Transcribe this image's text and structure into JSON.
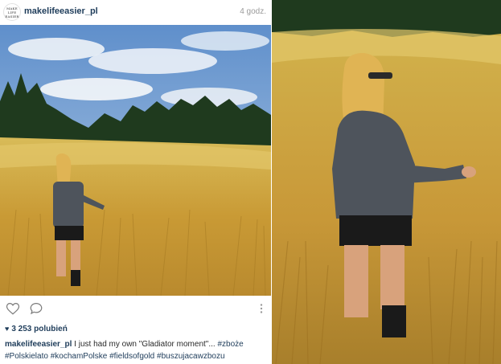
{
  "post": {
    "avatar_text": [
      "MAKE",
      "LIFE",
      "EASIER"
    ],
    "username": "makelifeeasier_pl",
    "time": "4 godz.",
    "likes": "3 253 polubień",
    "caption_user": "makelifeeasier_pl",
    "caption_text": " I just had my own \"Gladiator moment\"... ",
    "hashtags": [
      "#zboże",
      "#Polskielato",
      "#kochamPolske",
      "#fieldsofgold",
      "#buszujacawzbozu"
    ]
  },
  "icons": {
    "like": "heart-outline-icon",
    "comment": "comment-bubble-icon",
    "more": "vertical-dots-icon",
    "likes": "heart-filled-icon"
  },
  "colors": {
    "username": "#1e3c5a",
    "time": "#9a9a9a",
    "sky": "#7ea8d6",
    "trees": "#1f3a1e",
    "wheat": "#d4ad4a",
    "sweater": "#4e545c"
  }
}
